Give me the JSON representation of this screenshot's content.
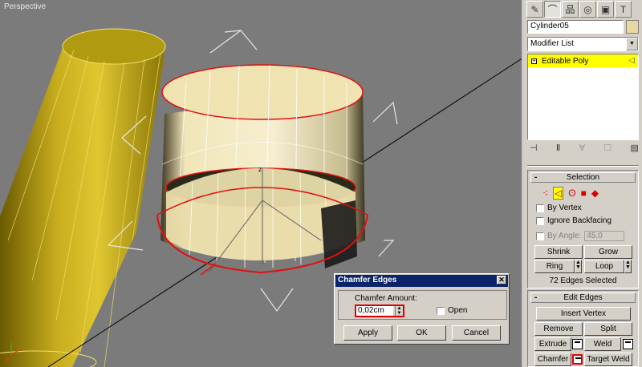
{
  "viewport": {
    "label": "Perspective"
  },
  "command_panel": {
    "tabs": [
      {
        "icon": "create-icon",
        "glyph": "✎"
      },
      {
        "icon": "modify-icon",
        "glyph": "⌒"
      },
      {
        "icon": "hierarchy-icon",
        "glyph": "品"
      },
      {
        "icon": "motion-icon",
        "glyph": "◎"
      },
      {
        "icon": "display-icon",
        "glyph": "▣"
      },
      {
        "icon": "utilities-icon",
        "glyph": "T"
      }
    ],
    "object_name": "Cylinder05",
    "object_color": "#e8d8a0",
    "modifier_list": "Modifier List",
    "stack": [
      {
        "label": "Editable Poly",
        "highlight": "#ffff00"
      }
    ]
  },
  "selection": {
    "title": "Selection",
    "by_vertex": "By Vertex",
    "ignore_backfacing": "Ignore Backfacing",
    "by_angle": "By Angle:",
    "angle_value": "45,0",
    "shrink": "Shrink",
    "grow": "Grow",
    "ring": "Ring",
    "loop": "Loop",
    "status": "72 Edges Selected"
  },
  "edit_edges": {
    "title": "Edit Edges",
    "insert_vertex": "Insert Vertex",
    "remove": "Remove",
    "split": "Split",
    "extrude": "Extrude",
    "weld": "Weld",
    "chamfer": "Chamfer",
    "target_weld": "Target Weld"
  },
  "dialog": {
    "title": "Chamfer Edges",
    "amount_label": "Chamfer Amount:",
    "amount_value": "0,02cm",
    "open_label": "Open",
    "apply": "Apply",
    "ok": "OK",
    "cancel": "Cancel"
  }
}
